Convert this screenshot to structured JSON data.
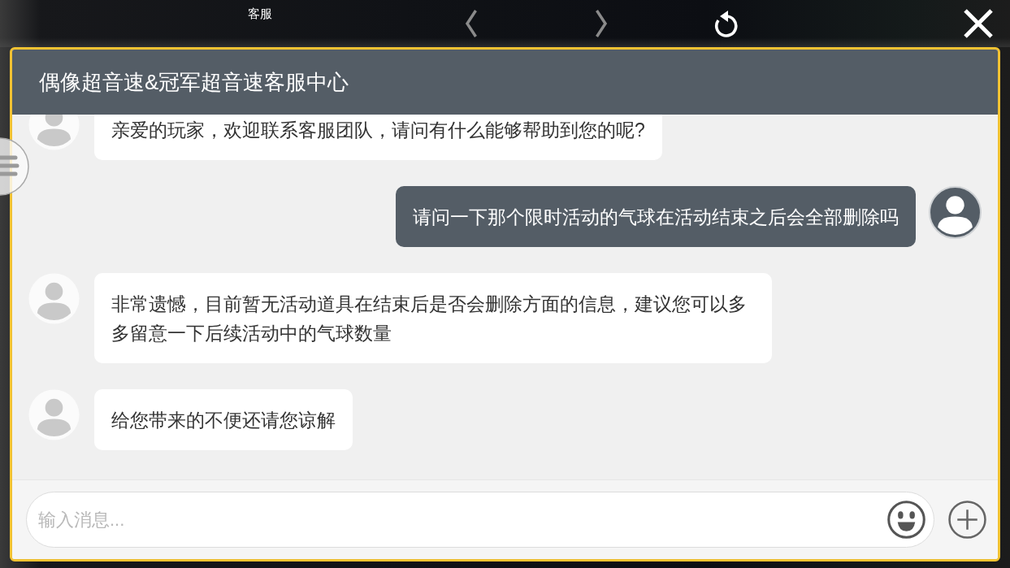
{
  "top_bar": {
    "title": "客服",
    "toolbar": [
      {
        "kind": "back",
        "disabled": true
      },
      {
        "kind": "forward",
        "disabled": true
      },
      {
        "kind": "refresh",
        "disabled": false
      },
      {
        "kind": "close",
        "disabled": false
      }
    ]
  },
  "window": {
    "title": "偶像超音速&冠军超音速客服中心"
  },
  "messages": [
    {
      "kind": "agent",
      "text": "亲爱的玩家，欢迎联系客服团队，请问有什么能够帮助到您的呢?"
    },
    {
      "kind": "user",
      "text": "请问一下那个限时活动的气球在活动结束之后会全部删除吗"
    },
    {
      "kind": "agent",
      "text": "非常遗憾，目前暂无活动道具在结束后是否会删除方面的信息，建议您可以多多留意一下后续活动中的气球数量"
    },
    {
      "kind": "agent",
      "text": "给您带来的不便还请您谅解"
    }
  ],
  "input": {
    "placeholder": "输入消息..."
  }
}
